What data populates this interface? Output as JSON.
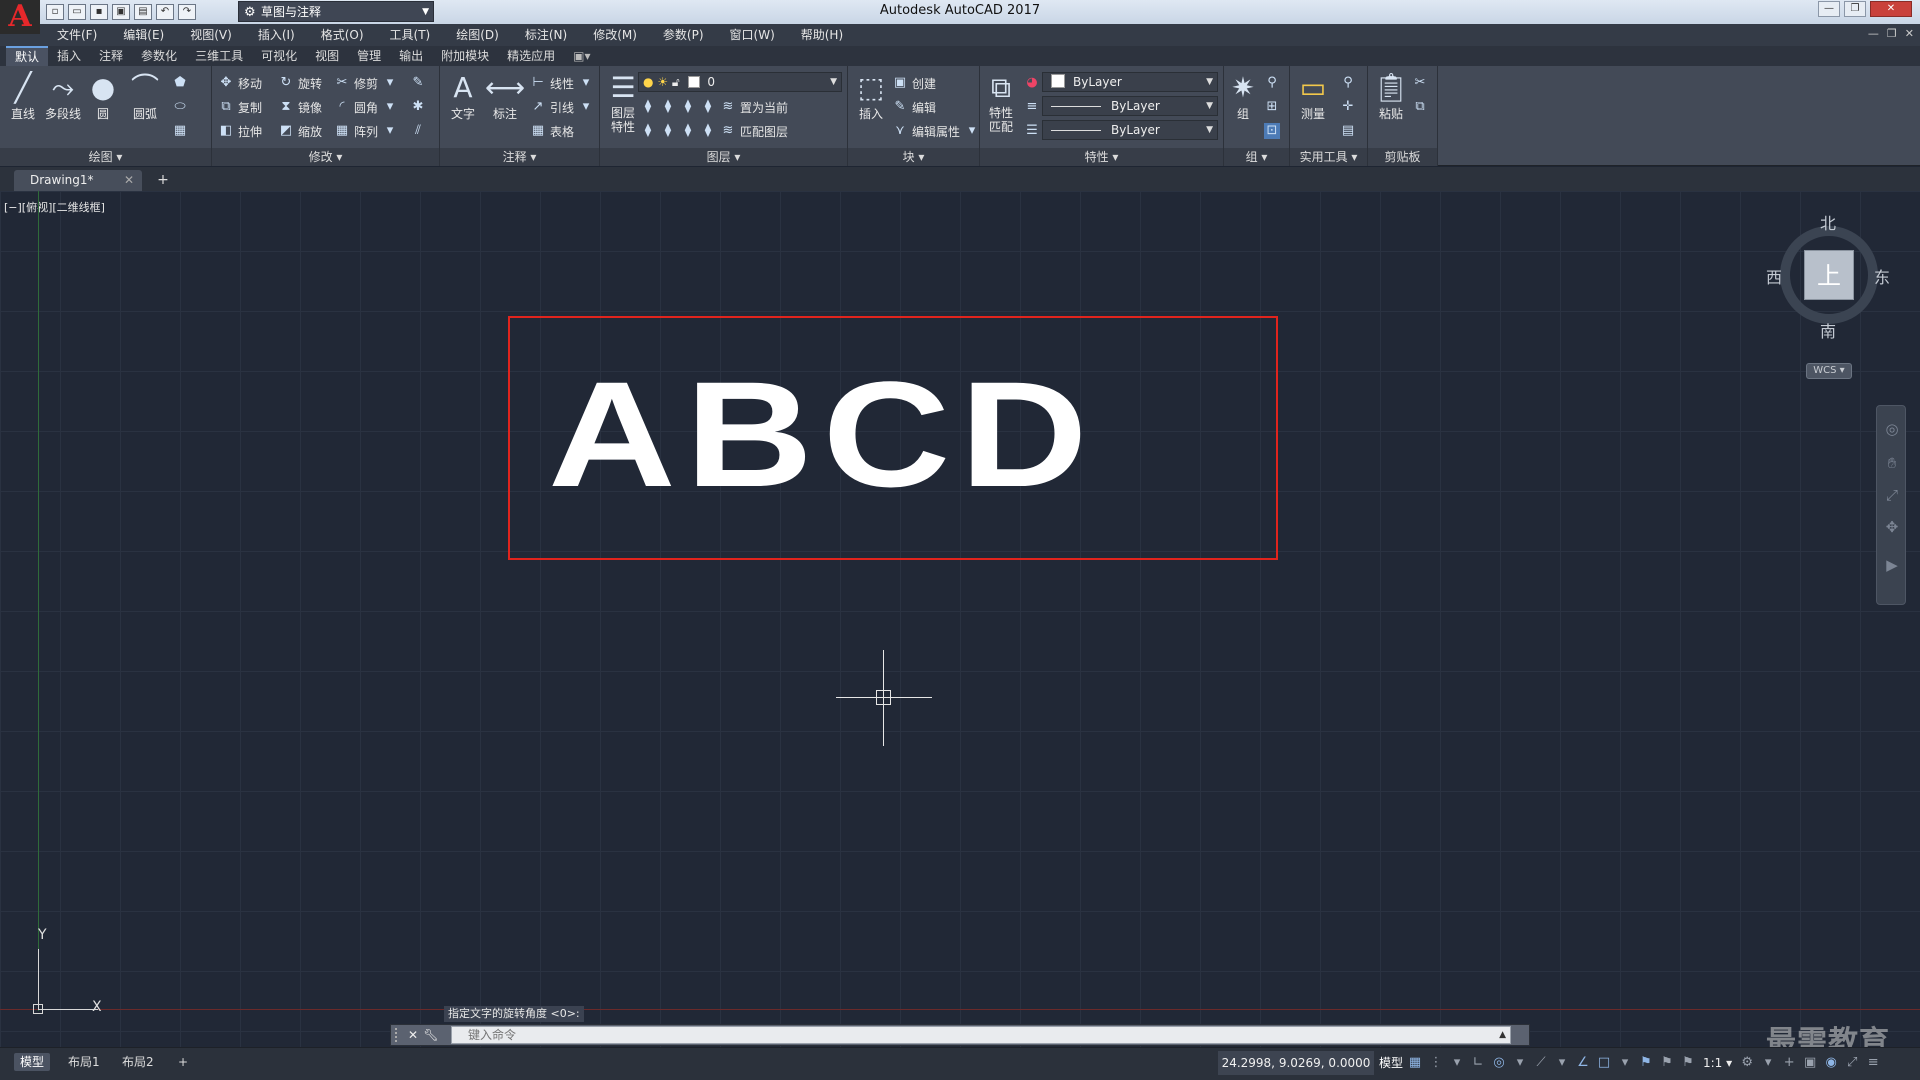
{
  "app": {
    "title": "Autodesk AutoCAD 2017",
    "logo": "A",
    "workspace": "草图与注释"
  },
  "menus": [
    "文件(F)",
    "编辑(E)",
    "视图(V)",
    "插入(I)",
    "格式(O)",
    "工具(T)",
    "绘图(D)",
    "标注(N)",
    "修改(M)",
    "参数(P)",
    "窗口(W)",
    "帮助(H)"
  ],
  "ribbon_tabs": [
    "默认",
    "插入",
    "注释",
    "参数化",
    "三维工具",
    "可视化",
    "视图",
    "管理",
    "输出",
    "附加模块",
    "精选应用"
  ],
  "ribbon_tab_extra": "▣▾",
  "ribbon": {
    "draw": {
      "title": "绘图 ▾",
      "line": "直线",
      "polyline": "多段线",
      "circle": "圆",
      "arc": "圆弧"
    },
    "modify": {
      "title": "修改 ▾",
      "move": "移动",
      "rotate": "旋转",
      "trim": "修剪",
      "copy": "复制",
      "mirror": "镜像",
      "fillet": "圆角",
      "stretch": "拉伸",
      "scale": "缩放",
      "array": "阵列"
    },
    "annotation": {
      "title": "注释 ▾",
      "text": "文字",
      "dimension": "标注",
      "linear": "线性",
      "leader": "引线",
      "table": "表格"
    },
    "layers": {
      "title": "图层 ▾",
      "layer_props_1": "图层",
      "layer_props_2": "特性",
      "layer_current": "0",
      "make_current": "置为当前",
      "match_layer": "匹配图层"
    },
    "block": {
      "title": "块 ▾",
      "insert": "插入",
      "create": "创建",
      "edit": "编辑",
      "edit_attr": "编辑属性"
    },
    "properties": {
      "title": "特性 ▾",
      "match_1": "特性",
      "match_2": "匹配",
      "color": "ByLayer",
      "linetype": "ByLayer",
      "lineweight": "ByLayer"
    },
    "groups": {
      "title": "组 ▾",
      "group": "组"
    },
    "utilities": {
      "title": "实用工具 ▾",
      "measure": "测量"
    },
    "clipboard": {
      "title": "剪贴板",
      "paste": "粘贴"
    }
  },
  "file_tab": {
    "name": "Drawing1*",
    "close": "✕",
    "new": "+"
  },
  "viewport_label": "[−][俯视][二维线框]",
  "drawing_text": "ABCD",
  "viewcube": {
    "north": "北",
    "south": "南",
    "east": "东",
    "west": "西",
    "face": "上",
    "wcs": "WCS ▾"
  },
  "ucs": {
    "x": "X",
    "y": "Y"
  },
  "command": {
    "prompt": "指定文字的旋转角度 <0>:",
    "placeholder": "键入命令"
  },
  "layout_tabs": [
    "模型",
    "布局1",
    "布局2"
  ],
  "layout_add": "+",
  "status": {
    "coords": "24.2998, 9.0269, 0.0000",
    "model": "模型",
    "scale": "1:1 ▾"
  },
  "watermark": "最需教育",
  "colors": {
    "canvas": "#212836",
    "rectangle": "#e0241d",
    "ribbon": "#434a57"
  }
}
